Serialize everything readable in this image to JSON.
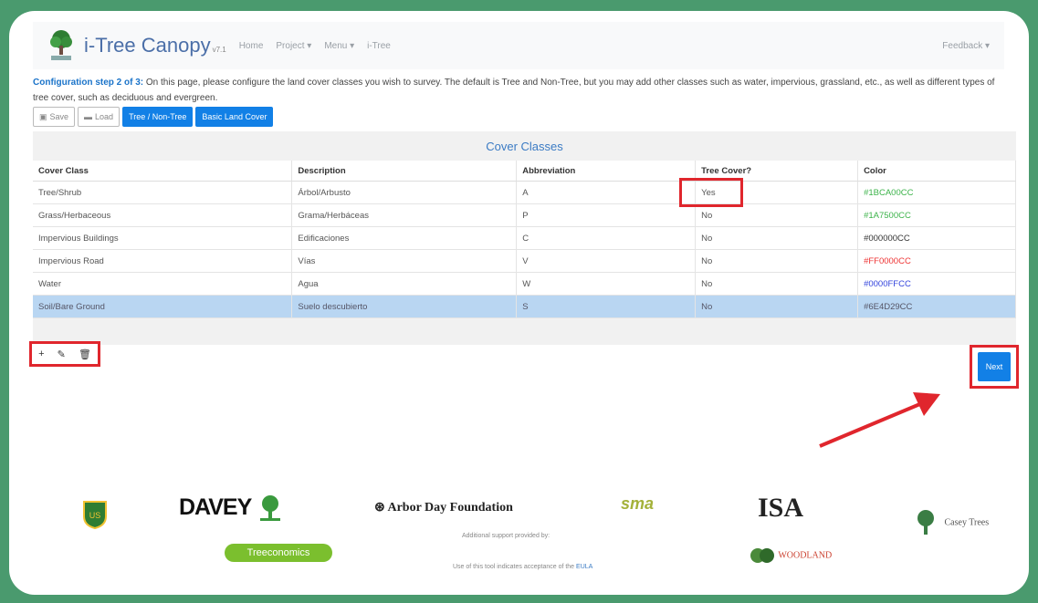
{
  "header": {
    "brand": "i-Tree Canopy",
    "brand_suffix": "v7.1",
    "nav": [
      "Home",
      "Project ▾",
      "Menu ▾",
      "i-Tree"
    ],
    "feedback": "Feedback ▾"
  },
  "intro": {
    "step": "Configuration step 2 of 3:",
    "text": " On this page, please configure the land cover classes you wish to survey. The default is Tree and Non-Tree, but you may add other classes such as water, impervious, grassland, etc., as well as different types of tree cover, such as deciduous and evergreen."
  },
  "toolbar": {
    "save": "Save",
    "load": "Load",
    "tree_nontree": "Tree / Non-Tree",
    "basic_land_cover": "Basic Land Cover"
  },
  "table": {
    "title": "Cover Classes",
    "columns": [
      "Cover Class",
      "Description",
      "Abbreviation",
      "Tree Cover?",
      "Color"
    ],
    "rows": [
      {
        "cover_class": "Tree/Shrub",
        "description": "Árbol/Arbusto",
        "abbreviation": "A",
        "tree_cover": "Yes",
        "color": "#1BCA00CC"
      },
      {
        "cover_class": "Grass/Herbaceous",
        "description": "Grama/Herbáceas",
        "abbreviation": "P",
        "tree_cover": "No",
        "color": "#1A7500CC"
      },
      {
        "cover_class": "Impervious Buildings",
        "description": "Edificaciones",
        "abbreviation": "C",
        "tree_cover": "No",
        "color": "#000000CC"
      },
      {
        "cover_class": "Impervious Road",
        "description": "Vías",
        "abbreviation": "V",
        "tree_cover": "No",
        "color": "#FF0000CC"
      },
      {
        "cover_class": "Water",
        "description": "Agua",
        "abbreviation": "W",
        "tree_cover": "No",
        "color": "#0000FFCC"
      },
      {
        "cover_class": "Soil/Bare Ground",
        "description": "Suelo descubierto",
        "abbreviation": "S",
        "tree_cover": "No",
        "color": "#6E4D29CC"
      }
    ]
  },
  "row_actions": {
    "add": "+",
    "edit": "✎",
    "delete": "🗑"
  },
  "next_button": "Next",
  "footer": {
    "davey": "DAVEY",
    "arbor": "Arbor Day Foundation",
    "sma": "sma",
    "isa": "ISA",
    "casey": "Casey Trees",
    "support": "Additional support provided by:",
    "treeconomics": "Treeconomics",
    "woodland": "WOODLAND",
    "usage_prefix": "Use of this tool indicates acceptance of the",
    "usage_link": "EULA"
  },
  "colors": {
    "accent": "#1280e6",
    "highlight_box": "#e0262d",
    "border_green": "#4a9a6e",
    "selected_row": "#b9d6f2"
  }
}
